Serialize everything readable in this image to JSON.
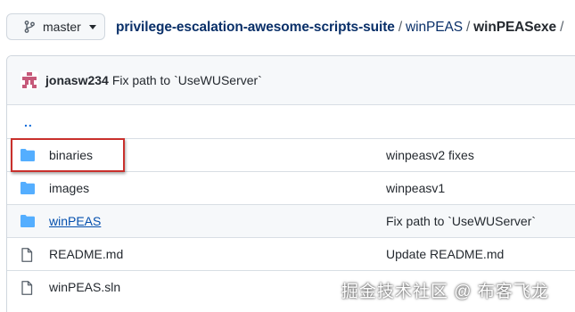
{
  "branch": {
    "label": "master",
    "icon": "git-branch-icon"
  },
  "breadcrumb": {
    "repo": "privilege-escalation-awesome-scripts-suite",
    "dir": "winPEAS",
    "current": "winPEASexe",
    "separator": "/"
  },
  "commit": {
    "author": "jonasw234",
    "message": "Fix path to `UseWUServer`"
  },
  "parent_link": "..",
  "files": [
    {
      "type": "folder",
      "name": "binaries",
      "message": "winpeasv2 fixes",
      "icon": "folder-icon"
    },
    {
      "type": "folder",
      "name": "images",
      "message": "winpeasv1",
      "icon": "folder-icon"
    },
    {
      "type": "folder",
      "name": "winPEAS",
      "message": "Fix path to `UseWUServer`",
      "icon": "folder-icon"
    },
    {
      "type": "file",
      "name": "README.md",
      "message": "Update README.md",
      "icon": "file-icon"
    },
    {
      "type": "file",
      "name": "winPEAS.sln",
      "message": "",
      "icon": "file-icon"
    }
  ],
  "watermark": "掘金技术社区 @ 布客飞龙",
  "colors": {
    "folder": "#54aeff",
    "link": "#0550ae",
    "highlight": "#c9302c"
  }
}
